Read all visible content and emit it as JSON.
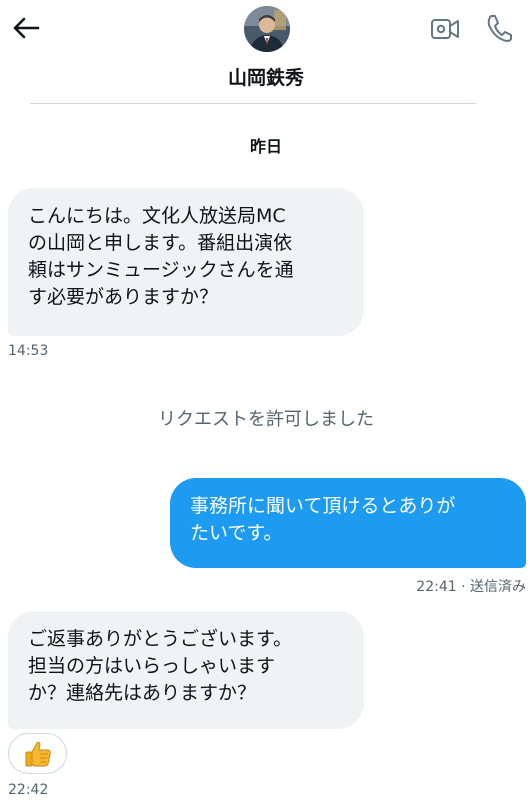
{
  "header": {
    "contact_name": "山岡鉄秀",
    "back_icon": "arrow-left-icon",
    "video_icon": "video-camera-icon",
    "call_icon": "phone-icon",
    "accent_color": "#1d9bf0"
  },
  "conversation": {
    "date_separator": "昨日",
    "messages": [
      {
        "direction": "received",
        "lines": [
          "こんにちは。文化人放送局MC",
          "の山岡と申します。番組出演依",
          "頼はサンミュージックさんを通",
          "す必要がありますか？"
        ],
        "time": "14:53"
      },
      {
        "direction": "system",
        "text": "リクエストを許可しました"
      },
      {
        "direction": "sent",
        "lines": [
          "事務所に聞いて頂けるとありが",
          "たいです。"
        ],
        "time": "22:41",
        "status": "送信済み",
        "separator": " · "
      },
      {
        "direction": "received",
        "lines": [
          "ご返事ありがとうございます。",
          "担当の方はいらっしゃいます",
          "か？連絡先はありますか？"
        ],
        "time": "22:42",
        "reaction": "👍"
      }
    ]
  }
}
